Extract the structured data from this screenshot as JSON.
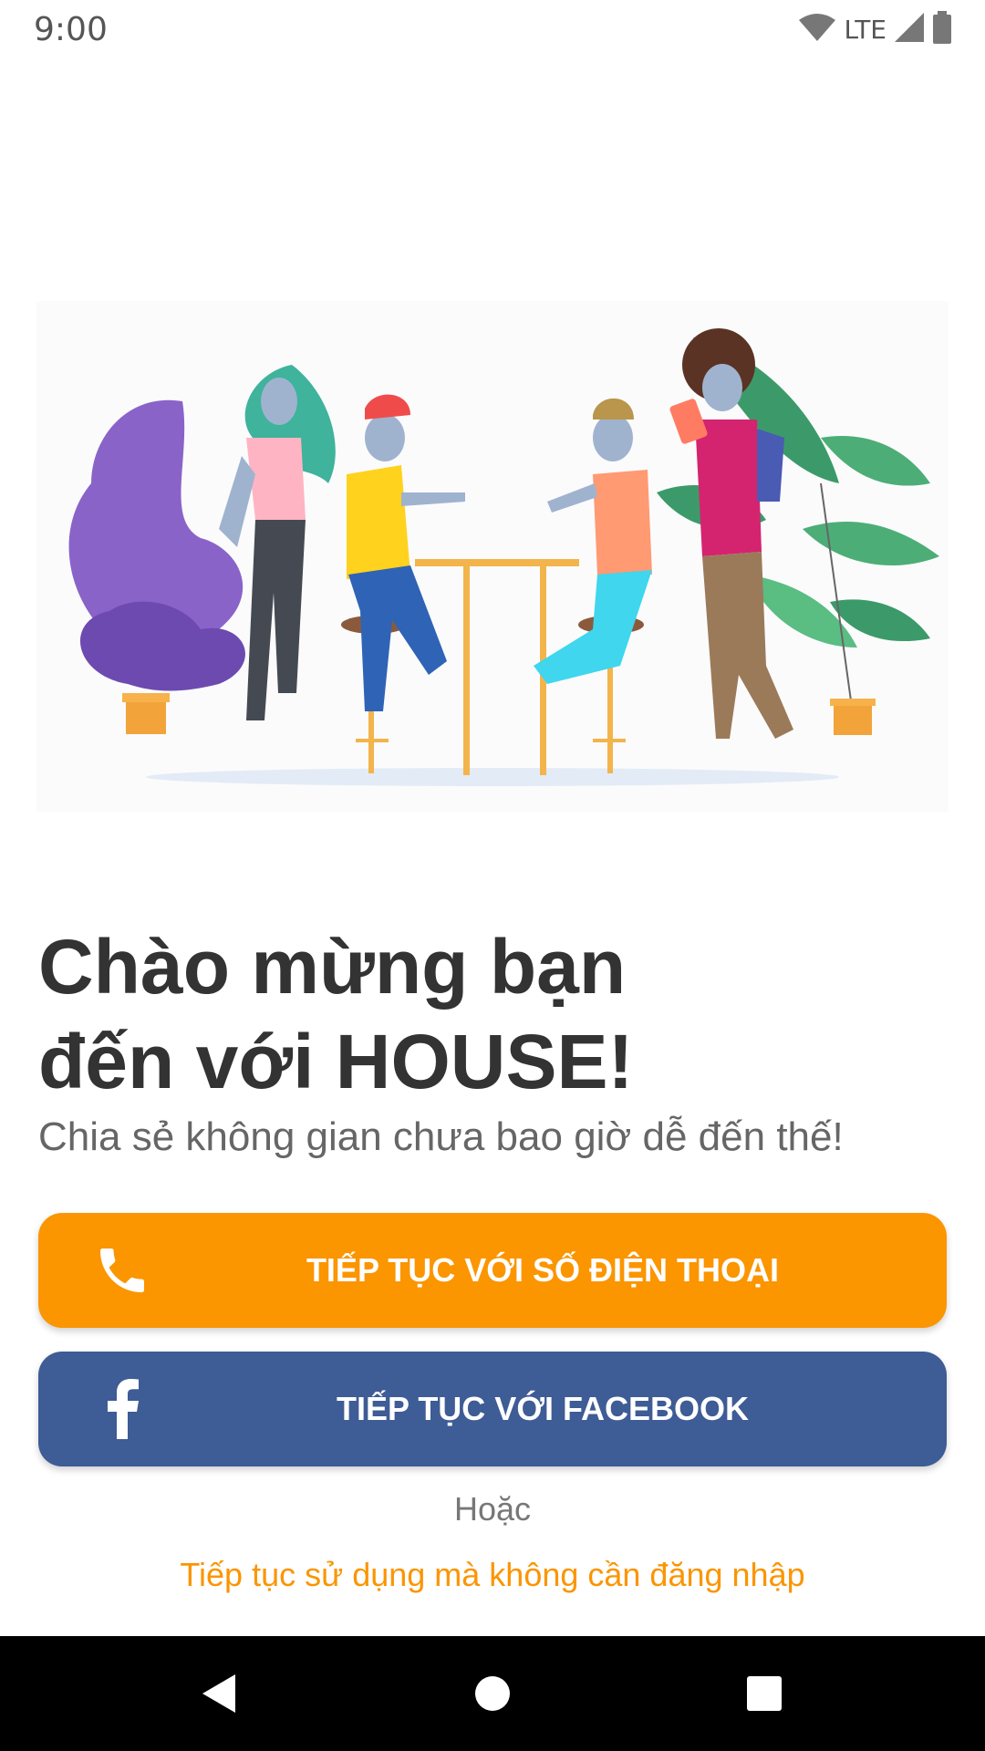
{
  "status_bar": {
    "time": "9:00",
    "network": "LTE",
    "icons": [
      "wifi-icon",
      "signal-icon",
      "battery-icon"
    ]
  },
  "illustration": {
    "name": "people-at-table-illustration"
  },
  "welcome": {
    "title_line1": "Chào mừng bạn",
    "title_line2": "đến với HOUSE!",
    "subtitle": "Chia sẻ không gian chưa bao giờ dễ đến thế!"
  },
  "buttons": {
    "phone": {
      "label": "TIẾP TỤC VỚI SỐ ĐIỆN THOẠI",
      "icon": "phone-icon",
      "color": "#fb9500"
    },
    "facebook": {
      "label": "TIẾP TỤC VỚI FACEBOOK",
      "icon": "facebook-icon",
      "color": "#3e5c95"
    }
  },
  "or_text": "Hoặc",
  "skip_link": "Tiếp tục sử dụng mà không cần đăng nhập",
  "nav_bar": {
    "icons": [
      "back-icon",
      "home-icon",
      "recents-icon"
    ]
  },
  "colors": {
    "accent": "#fb9500",
    "facebook": "#3e5c95",
    "title": "#333333",
    "subtitle": "#666666"
  }
}
